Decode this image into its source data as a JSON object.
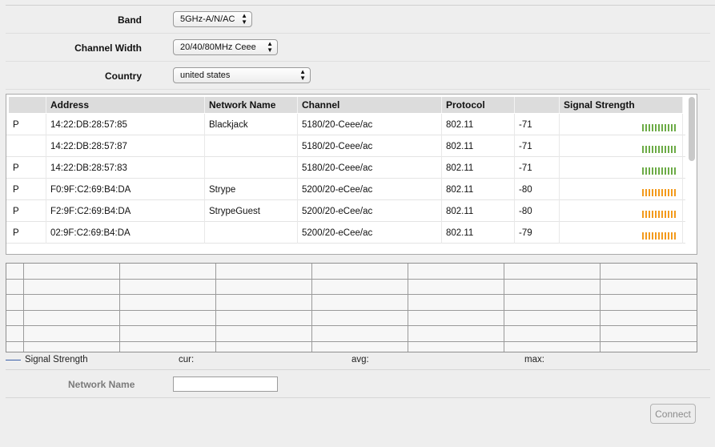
{
  "form": {
    "band": {
      "label": "Band",
      "value": "5GHz-A/N/AC"
    },
    "channel_width": {
      "label": "Channel Width",
      "value": "20/40/80MHz Ceee"
    },
    "country": {
      "label": "Country",
      "value": "united states"
    }
  },
  "scan_table": {
    "headers": [
      "",
      "Address",
      "Network Name",
      "Channel",
      "Protocol",
      "",
      "Signal Strength"
    ],
    "rows": [
      {
        "flag": "P",
        "address": "14:22:DB:28:57:85",
        "network": "Blackjack",
        "channel": "5180/20-Ceee/ac",
        "protocol": "802.11",
        "signal": "-71",
        "level": "green"
      },
      {
        "flag": "",
        "address": "14:22:DB:28:57:87",
        "network": "",
        "channel": "5180/20-Ceee/ac",
        "protocol": "802.11",
        "signal": "-71",
        "level": "green"
      },
      {
        "flag": "P",
        "address": "14:22:DB:28:57:83",
        "network": "",
        "channel": "5180/20-Ceee/ac",
        "protocol": "802.11",
        "signal": "-71",
        "level": "green"
      },
      {
        "flag": "P",
        "address": "F0:9F:C2:69:B4:DA",
        "network": "Strype",
        "channel": "5200/20-eCee/ac",
        "protocol": "802.11",
        "signal": "-80",
        "level": "orange"
      },
      {
        "flag": "P",
        "address": "F2:9F:C2:69:B4:DA",
        "network": "StrypeGuest",
        "channel": "5200/20-eCee/ac",
        "protocol": "802.11",
        "signal": "-80",
        "level": "orange"
      },
      {
        "flag": "P",
        "address": "02:9F:C2:69:B4:DA",
        "network": "",
        "channel": "5200/20-eCee/ac",
        "protocol": "802.11",
        "signal": "-79",
        "level": "orange"
      }
    ]
  },
  "legend": {
    "series": "Signal Strength",
    "cur": "cur:",
    "avg": "avg:",
    "max": "max:"
  },
  "network_name": {
    "label": "Network Name",
    "value": ""
  },
  "connect_label": "Connect",
  "colors": {
    "green": "#6cab46",
    "orange": "#f39a1c",
    "blue": "#4f9bd2"
  }
}
